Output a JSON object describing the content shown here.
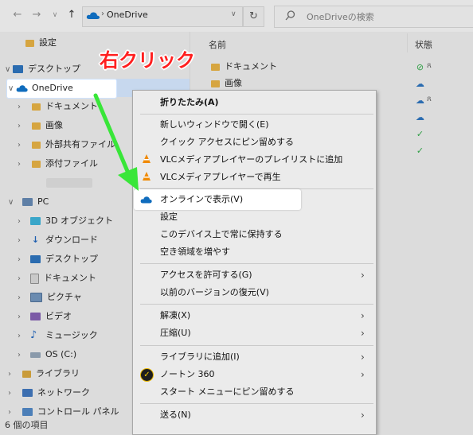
{
  "address_bar": {
    "location": "OneDrive",
    "search_placeholder": "OneDriveの検索",
    "back_icon": "arrow-left-icon",
    "forward_icon": "arrow-right-icon",
    "up_icon": "arrow-up-icon",
    "refresh_icon": "refresh-icon"
  },
  "nav": {
    "settings": "設定",
    "desktop_top": "デスクトップ",
    "onedrive": "OneDrive",
    "od_documents": "ドキュメント",
    "od_pictures": "画像",
    "od_shared": "外部共有ファイル",
    "od_attachments": "添付ファイル",
    "pc": "PC",
    "objects3d": "3D オブジェクト",
    "downloads": "ダウンロード",
    "desktop": "デスクトップ",
    "documents": "ドキュメント",
    "pictures": "ピクチャ",
    "videos": "ビデオ",
    "music": "ミュージック",
    "osc": "OS (C:)",
    "libraries": "ライブラリ",
    "network": "ネットワーク",
    "control_panel": "コントロール パネル"
  },
  "list": {
    "col_name": "名前",
    "col_status": "状態",
    "row1": "ドキュメント",
    "row2": "画像"
  },
  "status_bar": {
    "count": "6 個の項目"
  },
  "annotation": {
    "callout": "右クリック"
  },
  "context_menu": {
    "collapse": "折りたたみ(A)",
    "open_new_window": "新しいウィンドウで開く(E)",
    "pin_quick_access": "クイック アクセスにピン留めする",
    "vlc_add_playlist": "VLCメディアプレイヤーのプレイリストに追加",
    "vlc_play": "VLCメディアプレイヤーで再生",
    "view_online": "オンラインで表示(V)",
    "settings": "設定",
    "always_keep": "このデバイス上で常に保持する",
    "free_space": "空き領域を増やす",
    "give_access": "アクセスを許可する(G)",
    "restore_versions": "以前のバージョンの復元(V)",
    "extract": "解凍(X)",
    "compress": "圧縮(U)",
    "add_library": "ライブラリに追加(I)",
    "norton": "ノートン 360",
    "pin_start": "スタート メニューにピン留めする",
    "send_to": "送る(N)"
  },
  "colors": {
    "callout": "#ff1f1f",
    "arrow": "#39e639",
    "onedrive": "#0f6cbd"
  }
}
